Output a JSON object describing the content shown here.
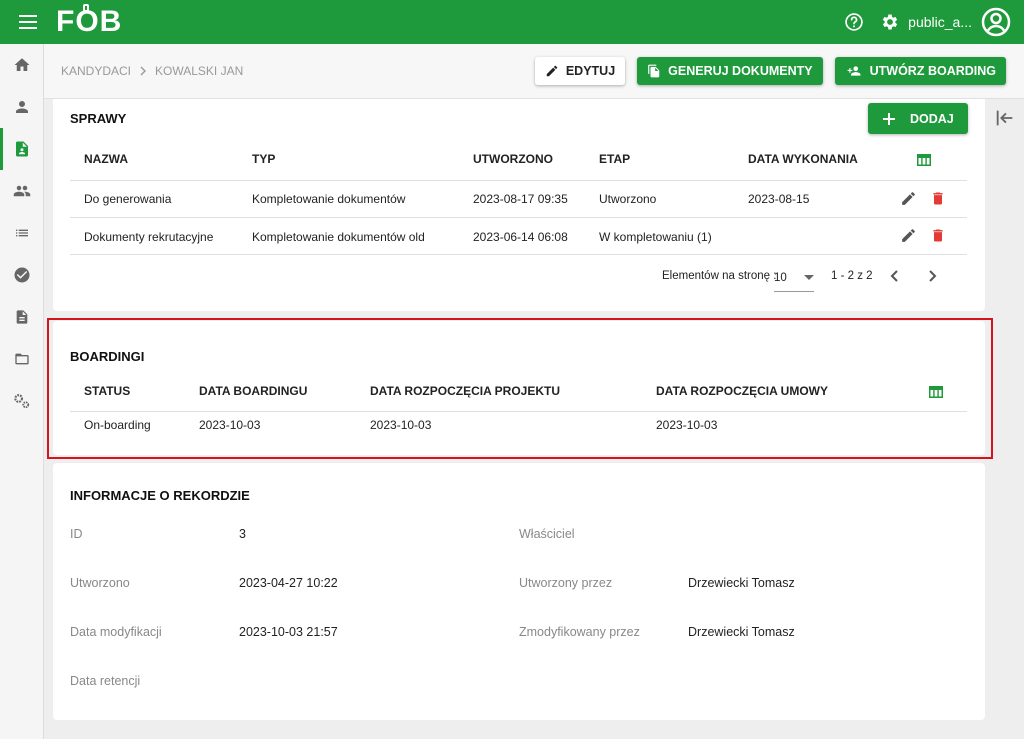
{
  "app": {
    "logo": "FOB",
    "username": "public_a..."
  },
  "icons": {
    "menu": "hamburger-menu-icon",
    "help": "help-circle-icon",
    "settings": "gear-icon",
    "account": "account-circle-icon"
  },
  "colors": {
    "brand": "#1e9a3c",
    "delete": "#e53935",
    "highlight": "#d6141b"
  },
  "breadcrumb": {
    "items": [
      "KANDYDACI",
      "KOWALSKI JAN"
    ]
  },
  "header_actions": {
    "edit": "EDYTUJ",
    "generate": "GENERUJ DOKUMENTY",
    "boarding": "UTWÓRZ BOARDING"
  },
  "sprawy": {
    "title": "SPRAWY",
    "add_label": "DODAJ",
    "columns": [
      "NAZWA",
      "TYP",
      "UTWORZONO",
      "ETAP",
      "DATA WYKONANIA"
    ],
    "rows": [
      {
        "nazwa": "Do generowania",
        "typ": "Kompletowanie dokumentów",
        "utworzono": "2023-08-17 09:35",
        "etap": "Utworzono",
        "data_wykonania": "2023-08-15"
      },
      {
        "nazwa": "Dokumenty rekrutacyjne",
        "typ": "Kompletowanie dokumentów old",
        "utworzono": "2023-06-14 06:08",
        "etap": "W kompletowaniu (1)",
        "data_wykonania": ""
      }
    ],
    "pager": {
      "label": "Elementów na stronę :",
      "page_size": "10",
      "range": "1 - 2 z 2"
    }
  },
  "boardingi": {
    "title": "BOARDINGI",
    "columns": [
      "STATUS",
      "DATA BOARDINGU",
      "DATA ROZPOCZĘCIA PROJEKTU",
      "DATA ROZPOCZĘCIA UMOWY"
    ],
    "rows": [
      {
        "status": "On-boarding",
        "data_boardingu": "2023-10-03",
        "data_projektu": "2023-10-03",
        "data_umowy": "2023-10-03"
      }
    ]
  },
  "info": {
    "title": "INFORMACJE O REKORDZIE",
    "id_label": "ID",
    "id_value": "3",
    "created_label": "Utworzono",
    "created_value": "2023-04-27 10:22",
    "modified_label": "Data modyfikacji",
    "modified_value": "2023-10-03 21:57",
    "retention_label": "Data retencji",
    "owner_label": "Właściciel",
    "created_by_label": "Utworzony przez",
    "created_by_value": "Drzewiecki Tomasz",
    "modified_by_label": "Zmodyfikowany przez",
    "modified_by_value": "Drzewiecki Tomasz"
  }
}
